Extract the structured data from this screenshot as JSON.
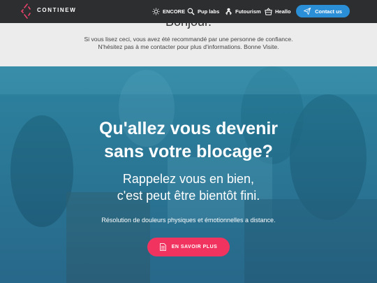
{
  "header": {
    "brand": "CONTINEW",
    "nav": [
      {
        "label": "ENCORE",
        "icon": "sun-icon"
      },
      {
        "label": "Pup labs",
        "icon": "magnifier-icon"
      },
      {
        "label": "Futourism",
        "icon": "person-icon"
      },
      {
        "label": "Heallo",
        "icon": "basket-icon"
      }
    ],
    "contact_label": "Contact us",
    "contact_icon": "paper-plane-icon"
  },
  "intro": {
    "title": "Bonjour.",
    "text": "Si vous lisez ceci, vous avez été recommandé par une personne de confiance. N'hésitez pas à me contacter pour plus d'informations. Bonne Visite."
  },
  "hero": {
    "title_line1": "Qu'allez vous devenir",
    "title_line2": "sans votre blocage?",
    "sub_line1": "Rappelez vous en bien,",
    "sub_line2": "c'est peut être bientôt fini.",
    "description": "Résolution de douleurs physiques et émotionnelles a distance.",
    "cta_label": "EN SAVOIR PLUS",
    "cta_icon": "document-icon"
  },
  "colors": {
    "topbar": "#2d2e30",
    "contact_button": "#2a8fd6",
    "cta_button": "#f0345f",
    "logo_accent": "#e8426a"
  }
}
